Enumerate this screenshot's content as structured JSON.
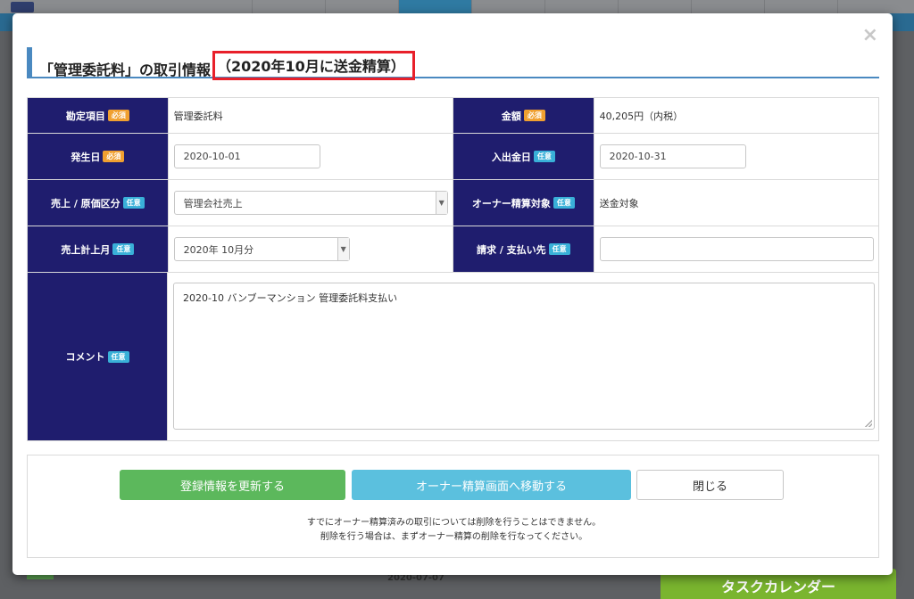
{
  "modal": {
    "title_main": "「管理委託料」の取引情報",
    "title_highlight": "（2020年10月に送金精算）",
    "close_glyph": "×"
  },
  "badges": {
    "required": "必須",
    "optional": "任意"
  },
  "fields": {
    "account_item": {
      "label": "勘定項目",
      "value": "管理委託料"
    },
    "amount": {
      "label": "金額",
      "value": "40,205円（内税）"
    },
    "occurrence_date": {
      "label": "発生日",
      "value": "2020-10-01"
    },
    "payment_date": {
      "label": "入出金日",
      "value": "2020-10-31"
    },
    "sales_category": {
      "label": "売上 / 原価区分",
      "value": "管理会社売上"
    },
    "owner_settlement": {
      "label": "オーナー精算対象",
      "value": "送金対象"
    },
    "sales_month": {
      "label": "売上計上月",
      "value": "2020年 10月分"
    },
    "billing_to": {
      "label": "請求 / 支払い先",
      "value": ""
    },
    "comment": {
      "label": "コメント",
      "value": "2020-10 バンブーマンション 管理委託料支払い"
    }
  },
  "buttons": {
    "update": "登録情報を更新する",
    "owner_screen": "オーナー精算画面へ移動する",
    "close": "閉じる"
  },
  "notes": {
    "line1": "すでにオーナー精算済みの取引については削除を行うことはできません。",
    "line2": "削除を行う場合は、まずオーナー精算の削除を行なってください。"
  },
  "background": {
    "date_text": "2020-07-07",
    "task_calendar": "タスクカレンダー"
  },
  "colors": {
    "label_bg": "#1f1d6e",
    "accent_blue": "#4a89c0",
    "highlight_red": "#e8202a",
    "update_green": "#5cb85c",
    "owner_cyan": "#5bc0de",
    "required_orange": "#f0a030",
    "optional_blue": "#39b0d8"
  }
}
